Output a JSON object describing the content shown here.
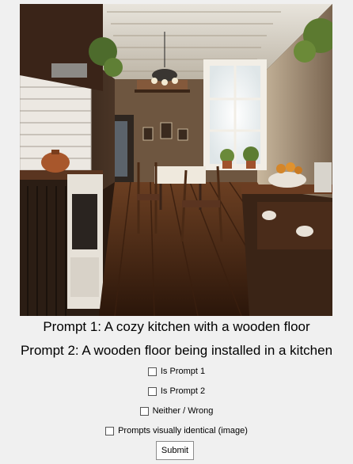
{
  "prompts": {
    "prompt_1": "Prompt 1: A cozy kitchen with a wooden floor",
    "prompt_2": "Prompt 2: A wooden floor being installed in a kitchen"
  },
  "options": [
    {
      "label": "Is Prompt 1",
      "checked": false
    },
    {
      "label": "Is Prompt 2",
      "checked": false
    },
    {
      "label": "Neither / Wrong",
      "checked": false
    },
    {
      "label": "Prompts visually identical (image)",
      "checked": false
    }
  ],
  "submit_label": "Submit",
  "image": {
    "subject": "cozy kitchen with wooden floor"
  }
}
